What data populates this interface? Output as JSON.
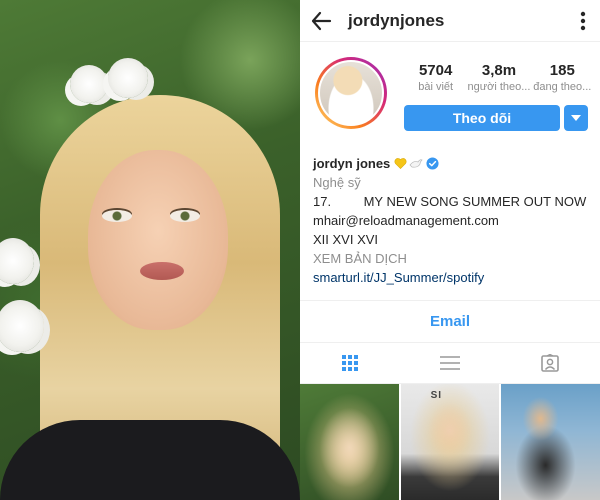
{
  "header": {
    "username": "jordynjones"
  },
  "profile": {
    "stats": [
      {
        "value": "5704",
        "label": "bài viết"
      },
      {
        "value": "3,8m",
        "label": "người theo..."
      },
      {
        "value": "185",
        "label": "đang theo..."
      }
    ],
    "follow_label": "Theo dõi"
  },
  "bio": {
    "name": "jordyn jones",
    "category": "Nghệ sỹ",
    "line1": "17.         MY NEW SONG SUMMER OUT NOW",
    "line2": "mhair@reloadmanagement.com",
    "line3": "XII XVI XVI",
    "translate": "XEM BẢN DỊCH",
    "link": "smarturl.it/JJ_Summer/spotify"
  },
  "contact": {
    "email_label": "Email"
  },
  "tabs": [
    {
      "icon": "grid-icon",
      "active": true
    },
    {
      "icon": "list-icon",
      "active": false
    },
    {
      "icon": "tagged-person-icon",
      "active": false
    }
  ],
  "grid": {
    "cell2_text": "SI"
  },
  "colors": {
    "accent": "#3897f0",
    "secondary_text": "#8e8e8e",
    "link": "#003569",
    "verified": "#3897f0",
    "heart": "#f5c518"
  }
}
